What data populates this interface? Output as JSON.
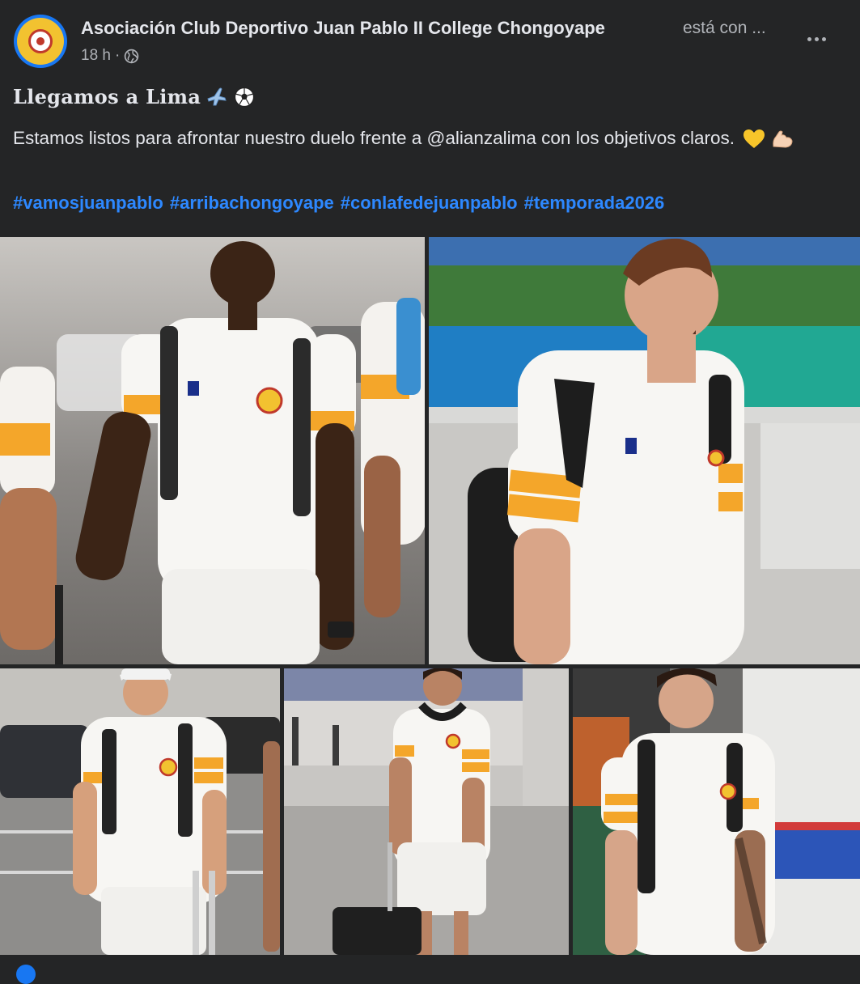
{
  "post": {
    "author": "Asociación Club Deportivo Juan Pablo II College Chongoyape",
    "with_text": "está con ...",
    "time": "18 h",
    "separator": "·",
    "audience_icon": "globe-icon",
    "more_icon": "more-options-icon",
    "title": "Llegamos a Lima",
    "title_emojis": [
      "airplane-emoji",
      "soccer-ball-emoji"
    ],
    "body_text": "Estamos listos para afrontar nuestro duelo frente a @alianzalima con los objetivos claros.",
    "body_emojis": [
      "yellow-heart-emoji",
      "flexed-biceps-emoji"
    ],
    "hashtags": [
      "#vamosjuanpablo",
      "#arribachongoyape",
      "#conlafedejuanpablo",
      "#temporada2026"
    ]
  },
  "photos": [
    {
      "name": "photo-player-airport-1"
    },
    {
      "name": "photo-player-airport-2"
    },
    {
      "name": "photo-player-airport-3"
    },
    {
      "name": "photo-player-airport-4"
    },
    {
      "name": "photo-player-airport-5"
    }
  ],
  "colors": {
    "background": "#242526",
    "text_primary": "#e4e6eb",
    "text_secondary": "#b0b3b8",
    "link": "#2d88ff",
    "accent": "#1877f2",
    "jersey_orange": "#f4a62a"
  }
}
